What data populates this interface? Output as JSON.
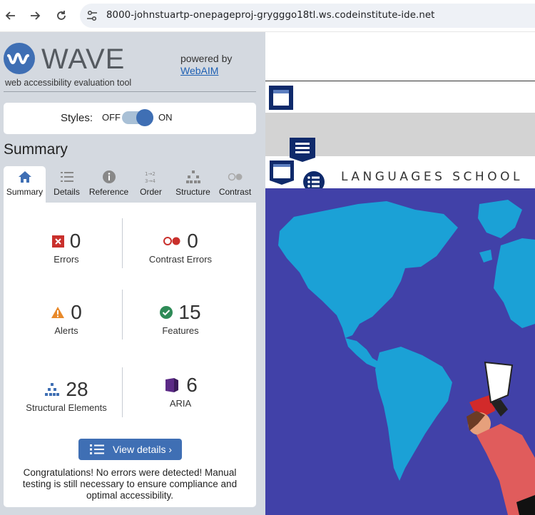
{
  "browser": {
    "url": "8000-johnstuartp-onepageproj-grygggo18tl.ws.codeinstitute-ide.net"
  },
  "wave": {
    "title": "WAVE",
    "subtitle": "web accessibility evaluation tool",
    "powered_by": "powered by",
    "webaim": "WebAIM",
    "styles_label": "Styles:",
    "styles_off": "OFF",
    "styles_on": "ON",
    "summary_heading": "Summary",
    "tabs": [
      {
        "label": "Summary",
        "icon": "home-icon"
      },
      {
        "label": "Details",
        "icon": "list-icon"
      },
      {
        "label": "Reference",
        "icon": "info-icon"
      },
      {
        "label": "Order",
        "icon": "order-icon"
      },
      {
        "label": "Structure",
        "icon": "structure-icon"
      },
      {
        "label": "Contrast",
        "icon": "contrast-icon"
      }
    ],
    "metrics": {
      "errors": {
        "value": "0",
        "label": "Errors"
      },
      "contrast_errors": {
        "value": "0",
        "label": "Contrast Errors"
      },
      "alerts": {
        "value": "0",
        "label": "Alerts"
      },
      "features": {
        "value": "15",
        "label": "Features"
      },
      "structural": {
        "value": "28",
        "label": "Structural Elements"
      },
      "aria": {
        "value": "6",
        "label": "ARIA"
      }
    },
    "view_details": "View details ›",
    "congrats": "Congratulations! No errors were detected! Manual testing is still necessary to ensure compliance and optimal accessibility."
  },
  "site": {
    "name": "LANGUAGES SCHOOL"
  },
  "colors": {
    "wave_blue": "#3f6fb4",
    "error_red": "#c9302c",
    "alert_orange": "#e8892a",
    "feature_green": "#2e8b57",
    "aria_purple": "#5b2a86",
    "map_blue": "#4141a8",
    "land": "#1ba1d6"
  }
}
